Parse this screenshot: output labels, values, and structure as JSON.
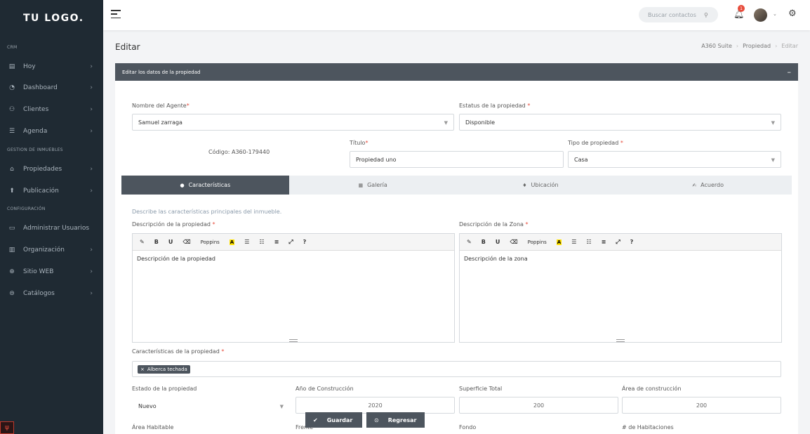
{
  "logo": "TU LOGO.",
  "sidebar": {
    "sections": [
      "CRM",
      "GESTION DE INMUEBLES",
      "CONFIGURACIÓN"
    ],
    "items": [
      {
        "label": "Hoy",
        "icon": "calendar-icon"
      },
      {
        "label": "Dashboard",
        "icon": "dashboard-icon"
      },
      {
        "label": "Clientes",
        "icon": "users-icon"
      },
      {
        "label": "Agenda",
        "icon": "agenda-icon"
      },
      {
        "label": "Propiedades",
        "icon": "home-icon"
      },
      {
        "label": "Publicación",
        "icon": "publish-icon"
      },
      {
        "label": "Administrar Usuarios",
        "icon": "admin-icon"
      },
      {
        "label": "Organización",
        "icon": "organization-icon"
      },
      {
        "label": "Sitio WEB",
        "icon": "globe-icon"
      },
      {
        "label": "Catálogos",
        "icon": "catalog-icon"
      }
    ]
  },
  "topbar": {
    "search_placeholder": "Buscar contactos",
    "notification_count": "1"
  },
  "page": {
    "title": "Editar",
    "breadcrumb": [
      "A360 Suite",
      "Propiedad",
      "Editar"
    ]
  },
  "card": {
    "header": "Editar los datos de la propiedad",
    "agent_label": "Nombre del Agente",
    "agent_value": "Samuel zarraga",
    "status_label": "Estatus de la propiedad ",
    "status_value": "Disponible",
    "code": "Código: A360-179440",
    "title_label": "Título",
    "title_value": "Propiedad uno",
    "type_label": "Tipo de propiedad ",
    "type_value": "Casa"
  },
  "tabs": [
    "Características",
    "Galería",
    "Ubicación",
    "Acuerdo"
  ],
  "form": {
    "hint": "Describe las características principales del inmueble.",
    "desc_property_label": "Descripción de la propiedad ",
    "desc_property_value": "Descripción de la propiedad",
    "desc_zone_label": "Descripción de la Zona ",
    "desc_zone_value": "Descripción de la zona",
    "editor_font": "Poppins",
    "features_label": "Características de la propiedad ",
    "features_tags": [
      "Alberca techada"
    ],
    "state_label": "Estado de la propiedad",
    "state_value": "Nuevo",
    "year_label": "Año de Construcción",
    "year_value": "2020",
    "surface_label": "Superficie Total",
    "surface_value": "200",
    "built_label": "Área de construcción",
    "built_value": "200",
    "habitable_label": "Área Habitable",
    "front_label": "Frente",
    "depth_label": "Fondo",
    "rooms_label": "# de Habitaciones"
  },
  "buttons": {
    "save": "Guardar",
    "back": "Regresar"
  }
}
